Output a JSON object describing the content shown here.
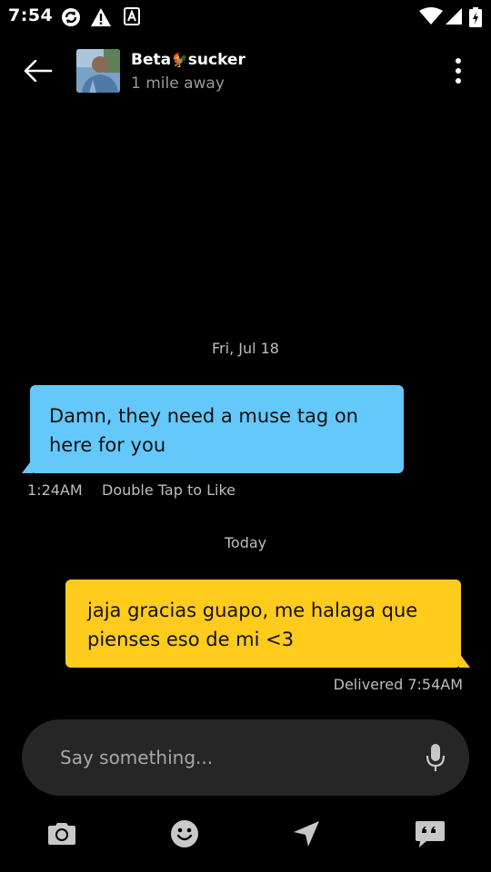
{
  "status_bar": {
    "time": "7:54",
    "icons": [
      "sync-icon",
      "warning-icon",
      "a-badge-icon",
      "wifi-icon",
      "signal-icon",
      "battery-icon"
    ]
  },
  "header": {
    "contact_name": "Beta",
    "contact_name_emoji": "🐓",
    "contact_name_suffix": "sucker",
    "distance": "1 mile away"
  },
  "messages": [
    {
      "date_label": "Fri, Jul 18"
    },
    {
      "direction": "incoming",
      "text": "Damn, they need a muse tag on here for you",
      "time": "1:24AM",
      "hint": "Double Tap to Like"
    },
    {
      "date_label": "Today"
    },
    {
      "direction": "outgoing",
      "text": "jaja gracias guapo, me halaga que pienses eso de mi <3",
      "status": "Delivered 7:54AM"
    }
  ],
  "composer": {
    "placeholder": "Say something..."
  },
  "toolbar": [
    "camera-icon",
    "emoji-icon",
    "location-icon",
    "quick-reply-icon"
  ],
  "colors": {
    "background": "#000000",
    "incoming_bubble": "#64c8fb",
    "outgoing_bubble": "#ffcb1d",
    "composer_bg": "#262626",
    "muted_text": "#bdbdbd",
    "icon_gray": "#c8c8c8"
  }
}
